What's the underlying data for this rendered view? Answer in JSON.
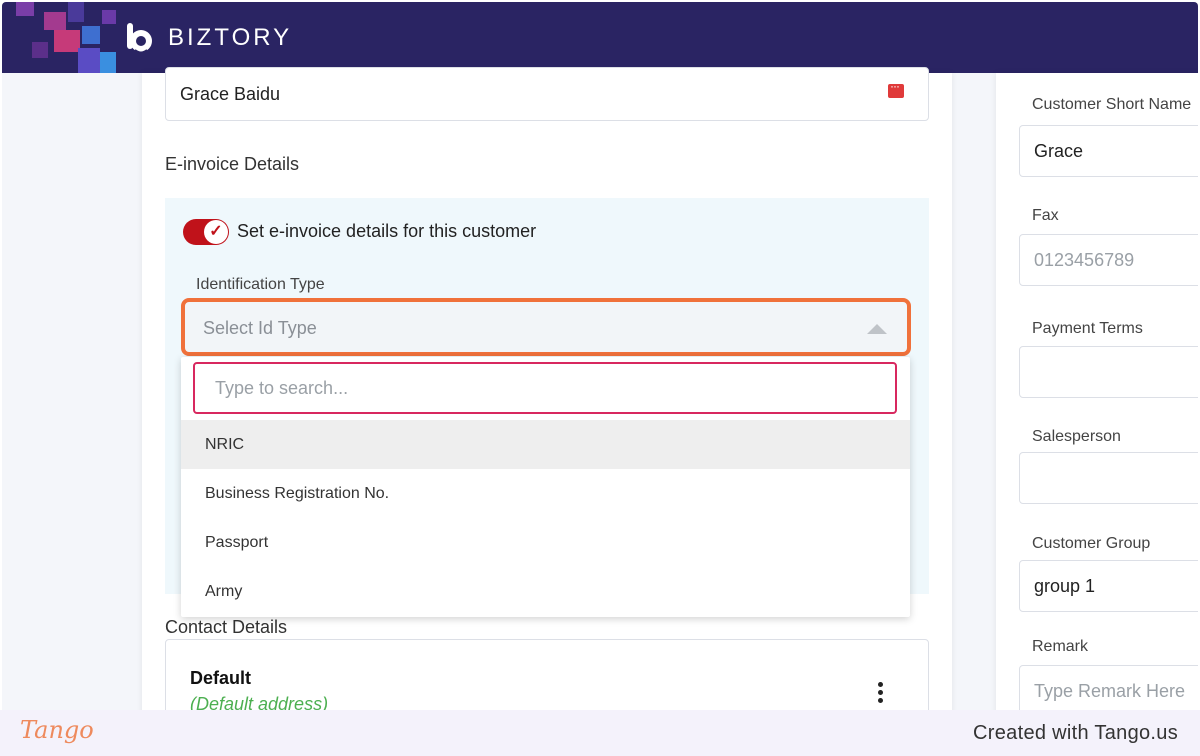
{
  "header": {
    "brand": "BIZTORY"
  },
  "customer_name": {
    "value": "Grace Baidu"
  },
  "einvoice": {
    "section_title": "E-invoice Details",
    "toggle_label": "Set e-invoice details for this customer",
    "toggle_on": true,
    "id_type_label": "Identification Type",
    "id_type_placeholder": "Select Id Type",
    "search_placeholder": "Type to search...",
    "options": [
      "NRIC",
      "Business Registration No.",
      "Passport",
      "Army"
    ],
    "highlighted_option": "NRIC"
  },
  "contact": {
    "section_title": "Contact Details",
    "name": "Default",
    "subtitle": "(Default address)"
  },
  "right_panel": {
    "short_name_label": "Customer Short Name",
    "short_name_value": "Grace",
    "fax_label": "Fax",
    "fax_placeholder": "0123456789",
    "payment_terms_label": "Payment Terms",
    "salesperson_label": "Salesperson",
    "customer_group_label": "Customer Group",
    "customer_group_value": "group 1",
    "remark_label": "Remark",
    "remark_placeholder": "Type Remark Here"
  },
  "footer": {
    "tango_logo": "Tango",
    "note": "Created with Tango.us"
  },
  "colors": {
    "header_bg": "#2a2463",
    "toggle_on": "#c0121a",
    "highlight_border": "#f0713b",
    "search_border": "#d8285f",
    "default_address": "#4caf50"
  }
}
